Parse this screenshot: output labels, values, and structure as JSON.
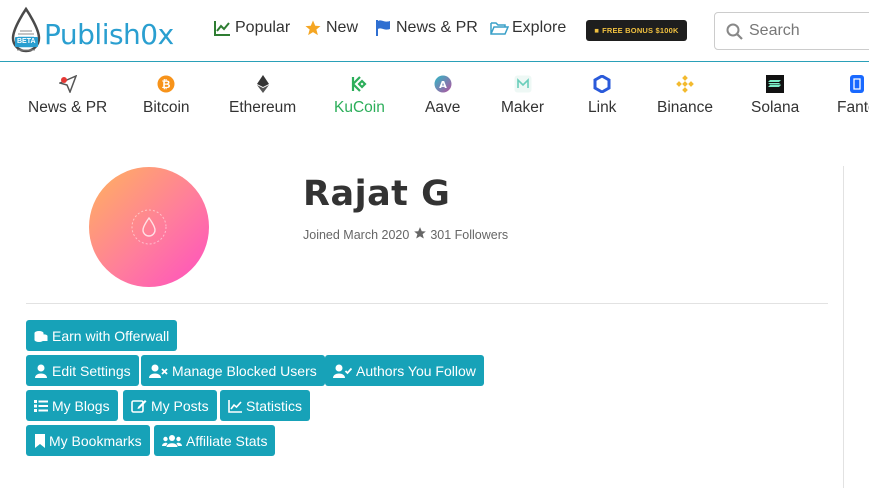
{
  "header": {
    "logo_text": "Publish0x",
    "logo_badge": "BETA",
    "nav": [
      {
        "label": "Popular",
        "icon": "chart-line-icon"
      },
      {
        "label": "New",
        "icon": "star-icon"
      },
      {
        "label": "News & PR",
        "icon": "flag-icon"
      },
      {
        "label": "Explore",
        "icon": "folder-open-icon"
      }
    ],
    "bonus_banner": "FREE BONUS $100K",
    "search": {
      "placeholder": "Search"
    }
  },
  "coins": [
    {
      "label": "News & PR",
      "icon": "paper-plane-icon"
    },
    {
      "label": "Bitcoin",
      "icon": "bitcoin-icon"
    },
    {
      "label": "Ethereum",
      "icon": "ethereum-icon"
    },
    {
      "label": "KuCoin",
      "icon": "kucoin-icon"
    },
    {
      "label": "Aave",
      "icon": "aave-icon"
    },
    {
      "label": "Maker",
      "icon": "maker-icon"
    },
    {
      "label": "Link",
      "icon": "chainlink-icon"
    },
    {
      "label": "Binance",
      "icon": "binance-icon"
    },
    {
      "label": "Solana",
      "icon": "solana-icon"
    },
    {
      "label": "Fanto",
      "icon": "fantom-icon"
    }
  ],
  "profile": {
    "name": "Rajat G",
    "joined": "Joined March 2020",
    "followers": "301 Followers"
  },
  "actions": [
    {
      "label": "Earn with Offerwall",
      "icon": "coins-icon"
    },
    {
      "label": "Edit Settings",
      "icon": "user-icon"
    },
    {
      "label": "Manage Blocked Users",
      "icon": "user-times-icon"
    },
    {
      "label": "Authors You Follow",
      "icon": "user-check-icon"
    },
    {
      "label": "My Blogs",
      "icon": "list-icon"
    },
    {
      "label": "My Posts",
      "icon": "edit-icon"
    },
    {
      "label": "Statistics",
      "icon": "chart-area-icon"
    },
    {
      "label": "My Bookmarks",
      "icon": "bookmark-icon"
    },
    {
      "label": "Affiliate Stats",
      "icon": "users-icon"
    }
  ],
  "colors": {
    "accent": "#17a2b8",
    "logo": "#2a9fd0",
    "kucoin_active": "#2cae5a"
  }
}
